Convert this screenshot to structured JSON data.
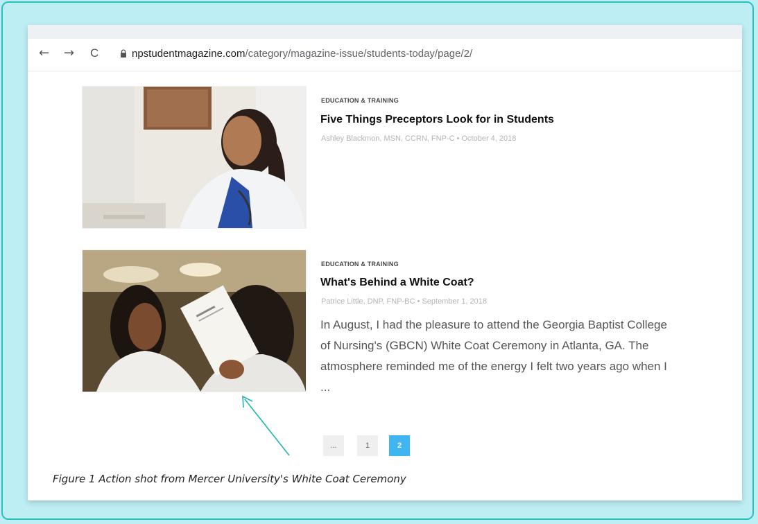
{
  "browser": {
    "nav_back": "←",
    "nav_forward": "→",
    "nav_reload": "C",
    "url_domain": "npstudentmagazine.com",
    "url_path": "/category/magazine-issue/students-today/page/2/"
  },
  "articles": [
    {
      "category": "EDUCATION & TRAINING",
      "title": "Five Things Preceptors Look for in Students",
      "meta": "Ashley Blackmon, MSN, CCRN, FNP-C • October 4, 2018"
    },
    {
      "category": "EDUCATION & TRAINING",
      "title": "What's Behind a White Coat?",
      "meta": "Patrice Little, DNP, FNP-BC • September 1, 2018",
      "excerpt": "In August, I had the pleasure to attend the Georgia Baptist College of Nursing's (GBCN) White Coat Ceremony in Atlanta, GA. The atmosphere reminded me of the energy I felt two years ago when I ..."
    }
  ],
  "pagination": {
    "ellipsis": "...",
    "page1": "1",
    "page2": "2"
  },
  "caption": "Figure 1 Action shot from Mercer University's White Coat Ceremony",
  "colors": {
    "background": "#bdeef4",
    "border": "#27c0c0",
    "active_page": "#3fb6f2",
    "arrow": "#1fb5b0"
  }
}
